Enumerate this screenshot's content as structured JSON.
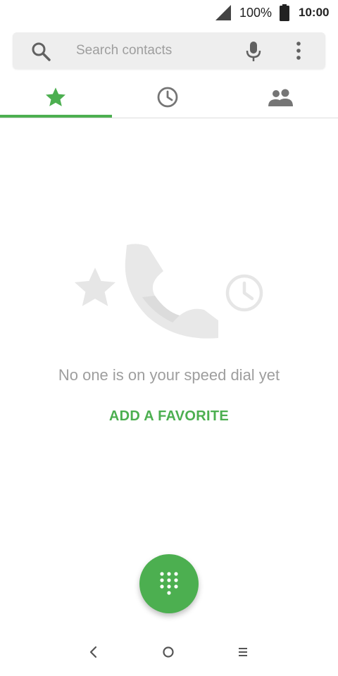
{
  "status_bar": {
    "battery_percent": "100%",
    "time": "10:00",
    "signal_icon": "cell-signal-icon",
    "battery_icon": "battery-full-icon"
  },
  "search": {
    "placeholder": "Search contacts",
    "value": "",
    "search_icon": "search-icon",
    "mic_icon": "mic-icon",
    "more_icon": "more-vert-icon"
  },
  "tabs": [
    {
      "name": "speed-dial",
      "icon": "star-icon",
      "selected": true
    },
    {
      "name": "recents",
      "icon": "clock-icon",
      "selected": false
    },
    {
      "name": "contacts",
      "icon": "people-icon",
      "selected": false
    }
  ],
  "empty_state": {
    "message": "No one is on your speed dial yet",
    "action_label": "ADD A FAVORITE"
  },
  "fab": {
    "icon": "dialpad-icon"
  },
  "nav": {
    "back_icon": "back-icon",
    "home_icon": "home-icon",
    "recents_icon": "recents-icon"
  },
  "colors": {
    "accent": "#4caf50",
    "icon_gray": "#757575",
    "illustration_gray": "#e0e0e0",
    "text_secondary": "#9e9e9e"
  }
}
